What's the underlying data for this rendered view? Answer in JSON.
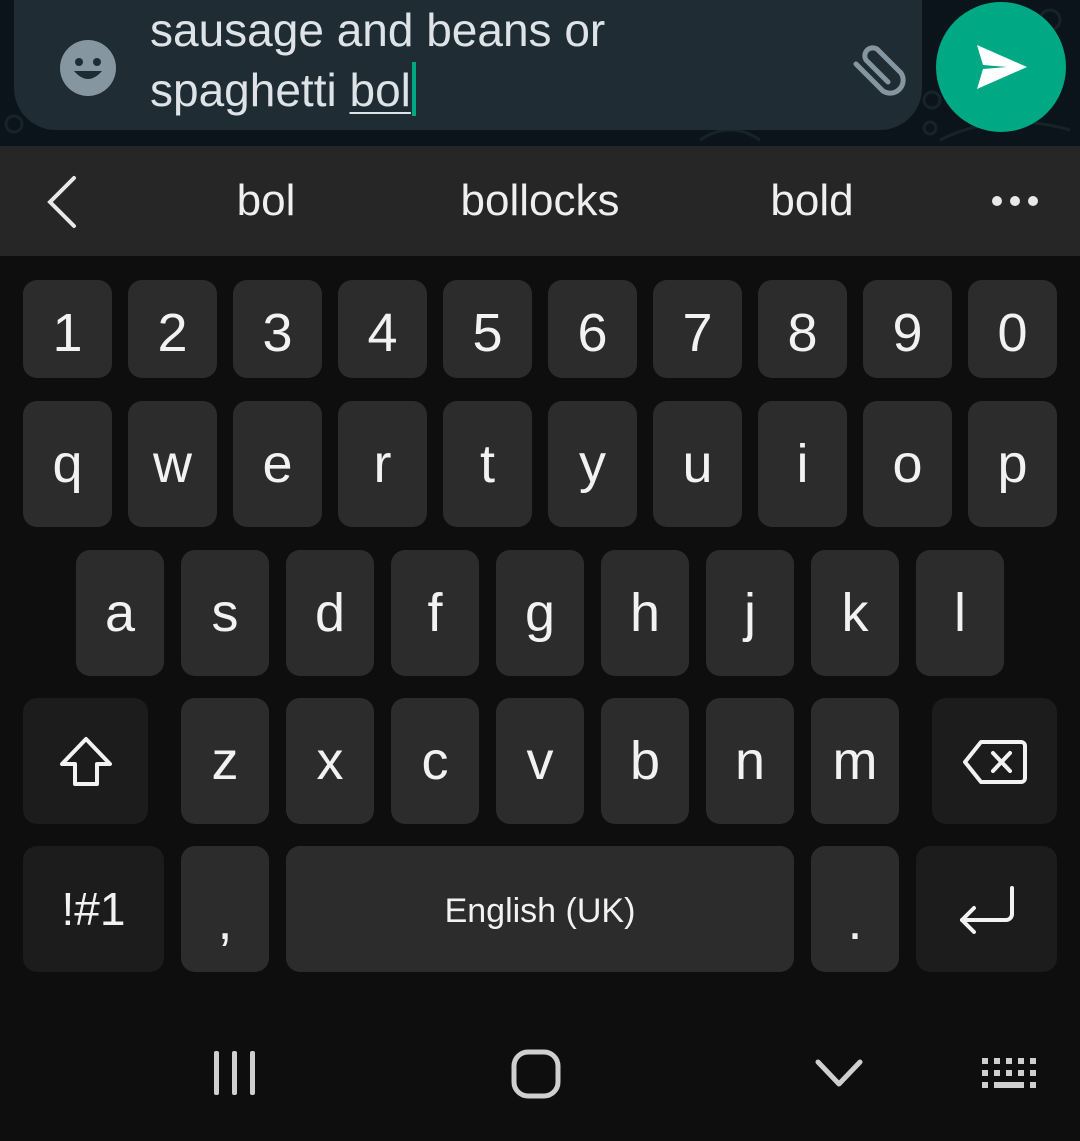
{
  "compose": {
    "text_before": "sausage and beans or\nspaghetti ",
    "current_word": "bol",
    "accent_color": "#00a884"
  },
  "icons": {
    "emoji": "emoji-smiley-icon",
    "attach": "paperclip-icon",
    "send": "send-arrow-icon",
    "back": "chevron-left-icon",
    "more": "more-dots-icon",
    "shift": "shift-arrow-icon",
    "backspace": "backspace-icon",
    "enter": "enter-return-icon",
    "nav_recents": "recent-apps-icon",
    "nav_home": "home-icon",
    "nav_hide": "hide-keyboard-icon",
    "nav_keyboard": "keyboard-switch-icon"
  },
  "suggestions": [
    "bol",
    "bollocks",
    "bold"
  ],
  "keyboard": {
    "row_numbers": [
      "1",
      "2",
      "3",
      "4",
      "5",
      "6",
      "7",
      "8",
      "9",
      "0"
    ],
    "row_top": [
      "q",
      "w",
      "e",
      "r",
      "t",
      "y",
      "u",
      "i",
      "o",
      "p"
    ],
    "row_middle": [
      "a",
      "s",
      "d",
      "f",
      "g",
      "h",
      "j",
      "k",
      "l"
    ],
    "row_bottom": [
      "z",
      "x",
      "c",
      "v",
      "b",
      "n",
      "m"
    ],
    "symbols_label": "!#1",
    "comma_label": ",",
    "space_label": "English (UK)",
    "period_label": "."
  }
}
